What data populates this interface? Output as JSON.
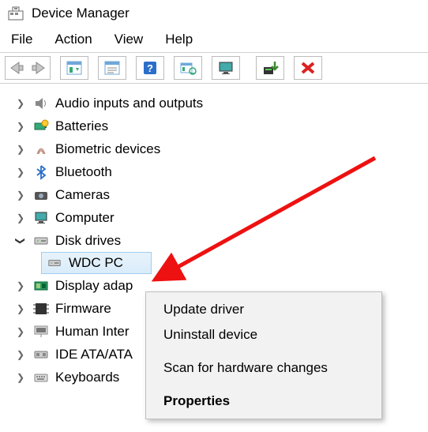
{
  "window": {
    "title": "Device Manager"
  },
  "menu": {
    "file": "File",
    "action": "Action",
    "view": "View",
    "help": "Help"
  },
  "tree": {
    "items": [
      {
        "label": "Audio inputs and outputs",
        "expanded": false
      },
      {
        "label": "Batteries",
        "expanded": false
      },
      {
        "label": "Biometric devices",
        "expanded": false
      },
      {
        "label": "Bluetooth",
        "expanded": false
      },
      {
        "label": "Cameras",
        "expanded": false
      },
      {
        "label": "Computer",
        "expanded": false
      },
      {
        "label": "Disk drives",
        "expanded": true,
        "child": "WDC PC"
      },
      {
        "label": "Display adap",
        "expanded": false
      },
      {
        "label": "Firmware",
        "expanded": false
      },
      {
        "label": "Human Inter",
        "expanded": false
      },
      {
        "label": "IDE ATA/ATA",
        "expanded": false
      },
      {
        "label": "Keyboards",
        "expanded": false
      }
    ]
  },
  "context_menu": {
    "update": "Update driver",
    "uninstall": "Uninstall device",
    "scan": "Scan for hardware changes",
    "properties": "Properties"
  },
  "icons": {
    "app": "device-manager-icon",
    "back": "back-arrow-icon",
    "forward": "forward-arrow-icon",
    "props": "properties-pane-icon",
    "props2": "properties-pane2-icon",
    "help": "help-icon",
    "scan": "scan-hardware-icon",
    "monitor": "monitor-icon",
    "upgrade": "install-driver-icon",
    "remove": "remove-icon"
  }
}
